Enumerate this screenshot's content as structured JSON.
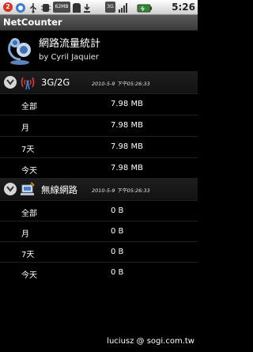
{
  "status_bar": {
    "notification_count": "2",
    "storage_label": "62MB",
    "network_label": "3G",
    "time": "5:26"
  },
  "title_bar": {
    "title": "NetCounter"
  },
  "app_header": {
    "name": "網路流量統計",
    "author": "by Cyril Jaquier"
  },
  "sections": [
    {
      "title": "3G/2G",
      "timestamp": "2010-5-9 下午05:26:33",
      "rows": [
        {
          "label": "全部",
          "value": "7.98 MB"
        },
        {
          "label": "月",
          "value": "7.98 MB"
        },
        {
          "label": "7天",
          "value": "7.98 MB"
        },
        {
          "label": "今天",
          "value": "7.98 MB"
        }
      ]
    },
    {
      "title": "無線網路",
      "timestamp": "2010-5-9 下午05:26:33",
      "rows": [
        {
          "label": "全部",
          "value": "0 B"
        },
        {
          "label": "月",
          "value": "0 B"
        },
        {
          "label": "7天",
          "value": "0 B"
        },
        {
          "label": "今天",
          "value": "0 B"
        }
      ]
    }
  ],
  "watermark": "luciusz @ sogi.com.tw"
}
